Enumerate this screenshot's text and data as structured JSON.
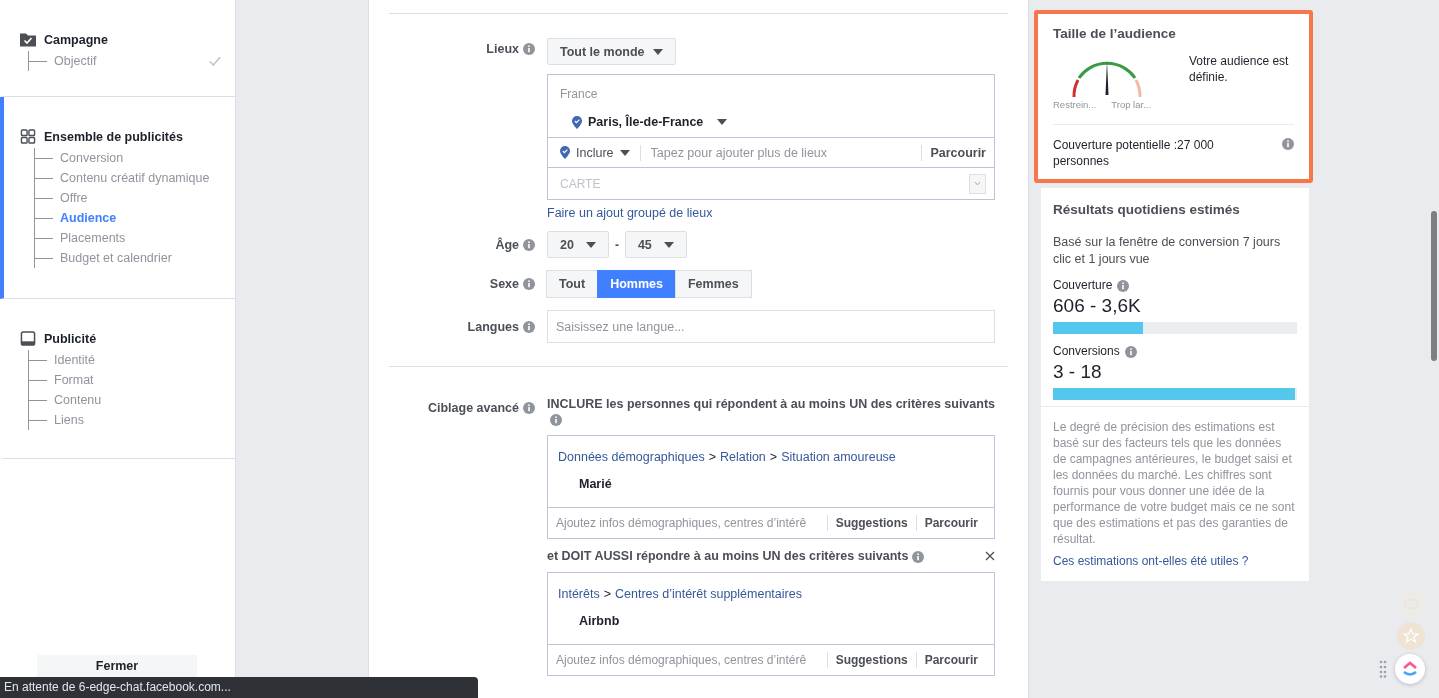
{
  "sidebar": {
    "sections": [
      {
        "title": "Campagne",
        "kind": "folder",
        "active": false,
        "items": [
          {
            "label": "Objectif",
            "selected": false,
            "done": true
          }
        ]
      },
      {
        "title": "Ensemble de publicités",
        "kind": "grid",
        "active": true,
        "items": [
          {
            "label": "Conversion",
            "selected": false,
            "done": false
          },
          {
            "label": "Contenu créatif dynamique",
            "selected": false,
            "done": false
          },
          {
            "label": "Offre",
            "selected": false,
            "done": false
          },
          {
            "label": "Audience",
            "selected": true,
            "done": false
          },
          {
            "label": "Placements",
            "selected": false,
            "done": false
          },
          {
            "label": "Budget et calendrier",
            "selected": false,
            "done": false
          }
        ]
      },
      {
        "title": "Publicité",
        "kind": "tablet",
        "active": false,
        "items": [
          {
            "label": "Identité",
            "selected": false,
            "done": false
          },
          {
            "label": "Format",
            "selected": false,
            "done": false
          },
          {
            "label": "Contenu",
            "selected": false,
            "done": false
          },
          {
            "label": "Liens",
            "selected": false,
            "done": false
          }
        ]
      }
    ],
    "close_button": "Fermer"
  },
  "form": {
    "locations": {
      "label": "Lieux",
      "dropdown": "Tout le monde",
      "country": "France",
      "location": "Paris, Île-de-France",
      "include": "Inclure",
      "placeholder": "Tapez pour ajouter plus de lieux",
      "browse": "Parcourir",
      "map": "CARTE",
      "bulk_link": "Faire un ajout groupé de lieux"
    },
    "age": {
      "label": "Âge",
      "min": "20",
      "separator": "-",
      "max": "45"
    },
    "sex": {
      "label": "Sexe",
      "options": [
        {
          "label": "Tout",
          "selected": false
        },
        {
          "label": "Hommes",
          "selected": true
        },
        {
          "label": "Femmes",
          "selected": false
        }
      ]
    },
    "languages": {
      "label": "Langues",
      "placeholder": "Saisissez une langue..."
    },
    "advanced": {
      "label": "Ciblage avancé",
      "include_text": "INCLURE les personnes qui répondent à au moins UN des critères suivants",
      "and_text": "et DOIT AUSSI répondre à au moins UN des critères suivants",
      "groups": [
        {
          "path": [
            {
              "kind": "link",
              "text": "Données démographiques"
            },
            {
              "kind": "separator",
              "text": ">"
            },
            {
              "kind": "link",
              "text": "Relation"
            },
            {
              "kind": "separator",
              "text": ">"
            },
            {
              "kind": "link",
              "text": "Situation amoureuse"
            }
          ],
          "value": "Marié",
          "placeholder": "Ajoutez infos démographiques, centres d’intérê",
          "suggestions": "Suggestions",
          "browse": "Parcourir"
        },
        {
          "path": [
            {
              "kind": "link",
              "text": "Intérêts"
            },
            {
              "kind": "separator",
              "text": ">"
            },
            {
              "kind": "link",
              "text": "Centres d’intérêt supplémentaires"
            }
          ],
          "value": "Airbnb",
          "placeholder": "Ajoutez infos démographiques, centres d’intérê",
          "suggestions": "Suggestions",
          "browse": "Parcourir"
        }
      ]
    }
  },
  "audience": {
    "title": "Taille de l’audience",
    "level": 0.5,
    "low_label": "Restrein...",
    "high_label": "Trop lar...",
    "status": "Votre audience est définie.",
    "coverage": "Couverture potentielle :27 000 personnes"
  },
  "results": {
    "title": "Résultats quotidiens estimés",
    "subtitle": "Basé sur la fenêtre de conversion 7 jours clic et 1 jours vue",
    "metrics": [
      {
        "label": "Couverture",
        "value": "606 - 3,6K",
        "level": 0.37
      },
      {
        "label": "Conversions",
        "value": "3 - 18",
        "level": 0.99
      }
    ],
    "disclaimer": "Le degré de précision des estimations est basé sur des facteurs tels que les données de campagnes antérieures, le budget saisi et les données du marché. Les chiffres sont fournis pour vous donner une idée de la performance de votre budget mais ce ne sont que des estimations et pas des garanties de résultat.",
    "feedback_link": "Ces estimations ont-elles été utiles ?"
  },
  "status_bar": "En attente de 6-edge-chat.facebook.com..."
}
